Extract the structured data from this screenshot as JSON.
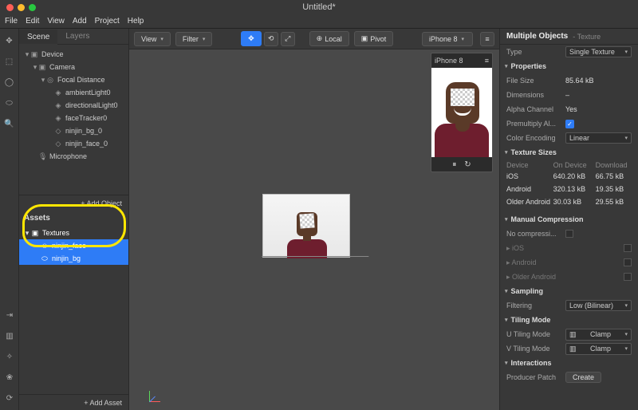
{
  "window": {
    "title": "Untitled*"
  },
  "menu": [
    "File",
    "Edit",
    "View",
    "Add",
    "Project",
    "Help"
  ],
  "left_tabs": {
    "scene": "Scene",
    "layers": "Layers"
  },
  "scene_tree": [
    {
      "indent": 0,
      "twist": "▾",
      "icon": "▣",
      "label": "Device"
    },
    {
      "indent": 1,
      "twist": "▾",
      "icon": "▣",
      "label": "Camera"
    },
    {
      "indent": 2,
      "twist": "▾",
      "icon": "◎",
      "label": "Focal Distance"
    },
    {
      "indent": 3,
      "twist": "",
      "icon": "◈",
      "label": "ambientLight0"
    },
    {
      "indent": 3,
      "twist": "",
      "icon": "◈",
      "label": "directionalLight0"
    },
    {
      "indent": 3,
      "twist": "",
      "icon": "◈",
      "label": "faceTracker0"
    },
    {
      "indent": 3,
      "twist": "",
      "icon": "◇",
      "label": "ninjin_bg_0"
    },
    {
      "indent": 3,
      "twist": "",
      "icon": "◇",
      "label": "ninjin_face_0"
    },
    {
      "indent": 1,
      "twist": "",
      "icon": "🎙",
      "label": "Microphone"
    }
  ],
  "add_object": "+  Add Object",
  "assets": {
    "header": "Assets",
    "items": [
      {
        "indent": 0,
        "twist": "▾",
        "icon": "▣",
        "label": "Textures",
        "selected": false
      },
      {
        "indent": 1,
        "twist": "",
        "icon": "☺",
        "label": "ninjin_face",
        "selected": true
      },
      {
        "indent": 1,
        "twist": "",
        "icon": "⬭",
        "label": "ninjin_bg",
        "selected": true
      }
    ],
    "add": "+  Add Asset"
  },
  "viewport": {
    "view_btn": "View",
    "filter_btn": "Filter",
    "local_btn": "Local",
    "pivot_btn": "Pivot",
    "device": "iPhone 8"
  },
  "inspector": {
    "title": "Multiple Objects",
    "subtitle": "- Texture",
    "type_label": "Type",
    "type_value": "Single Texture",
    "sections": {
      "properties": "Properties",
      "texture_sizes": "Texture Sizes",
      "manual_compression": "Manual Compression",
      "sampling": "Sampling",
      "tiling": "Tiling Mode",
      "interactions": "Interactions"
    },
    "props": {
      "file_size_l": "File Size",
      "file_size_v": "85.64 kB",
      "dimensions_l": "Dimensions",
      "dimensions_v": "–",
      "alpha_l": "Alpha Channel",
      "alpha_v": "Yes",
      "premult_l": "Premultiply Al...",
      "color_enc_l": "Color Encoding",
      "color_enc_v": "Linear"
    },
    "tex_cols": {
      "c1": "Device",
      "c2": "On Device",
      "c3": "Download"
    },
    "tex_rows": [
      {
        "c1": "iOS",
        "c2": "640.20 kB",
        "c3": "66.75 kB"
      },
      {
        "c1": "Android",
        "c2": "320.13 kB",
        "c3": "19.35 kB"
      },
      {
        "c1": "Older Android",
        "c2": "30.03 kB",
        "c3": "29.55 kB"
      }
    ],
    "mc": {
      "none": "No compressi...",
      "ios": "iOS",
      "android": "Android",
      "older": "Older Android"
    },
    "sampling": {
      "filtering_l": "Filtering",
      "filtering_v": "Low (Bilinear)"
    },
    "tiling": {
      "u_l": "U Tiling Mode",
      "u_v": "Clamp",
      "v_l": "V Tiling Mode",
      "v_v": "Clamp"
    },
    "interactions": {
      "patch_l": "Producer Patch",
      "create": "Create"
    }
  }
}
